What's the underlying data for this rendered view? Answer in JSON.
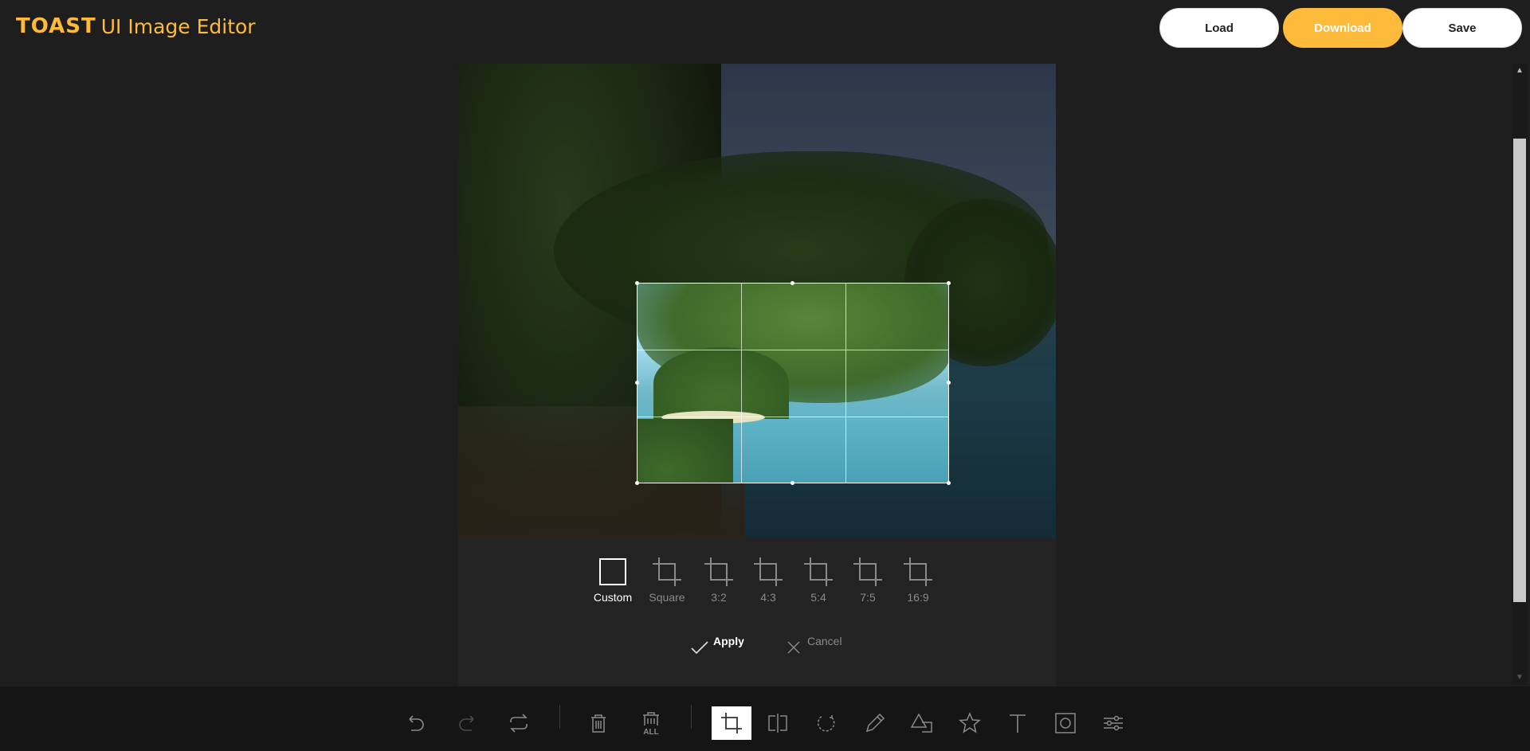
{
  "app": {
    "logo_bold": "TOAST",
    "logo_rest": "UI Image Editor",
    "brand_color": "#fdba3b"
  },
  "header": {
    "load_label": "Load",
    "download_label": "Download",
    "save_label": "Save"
  },
  "crop_menu": {
    "presets": [
      {
        "label": "Custom",
        "icon": "custom-crop-icon",
        "active": true
      },
      {
        "label": "Square",
        "icon": "crop-icon",
        "active": false
      },
      {
        "label": "3:2",
        "icon": "crop-icon",
        "active": false
      },
      {
        "label": "4:3",
        "icon": "crop-icon",
        "active": false
      },
      {
        "label": "5:4",
        "icon": "crop-icon",
        "active": false
      },
      {
        "label": "7:5",
        "icon": "crop-icon",
        "active": false
      },
      {
        "label": "16:9",
        "icon": "crop-icon",
        "active": false
      }
    ],
    "apply_label": "Apply",
    "cancel_label": "Cancel"
  },
  "toolbar": {
    "tools": [
      "undo-icon",
      "redo-icon",
      "reset-icon",
      "delete-icon",
      "delete-all-icon",
      "crop-icon",
      "flip-icon",
      "rotate-icon",
      "draw-icon",
      "shape-icon",
      "icon-star-icon",
      "text-icon",
      "mask-icon",
      "filter-icon"
    ],
    "delete_all_text": "ALL",
    "active_tool": "crop-icon"
  }
}
